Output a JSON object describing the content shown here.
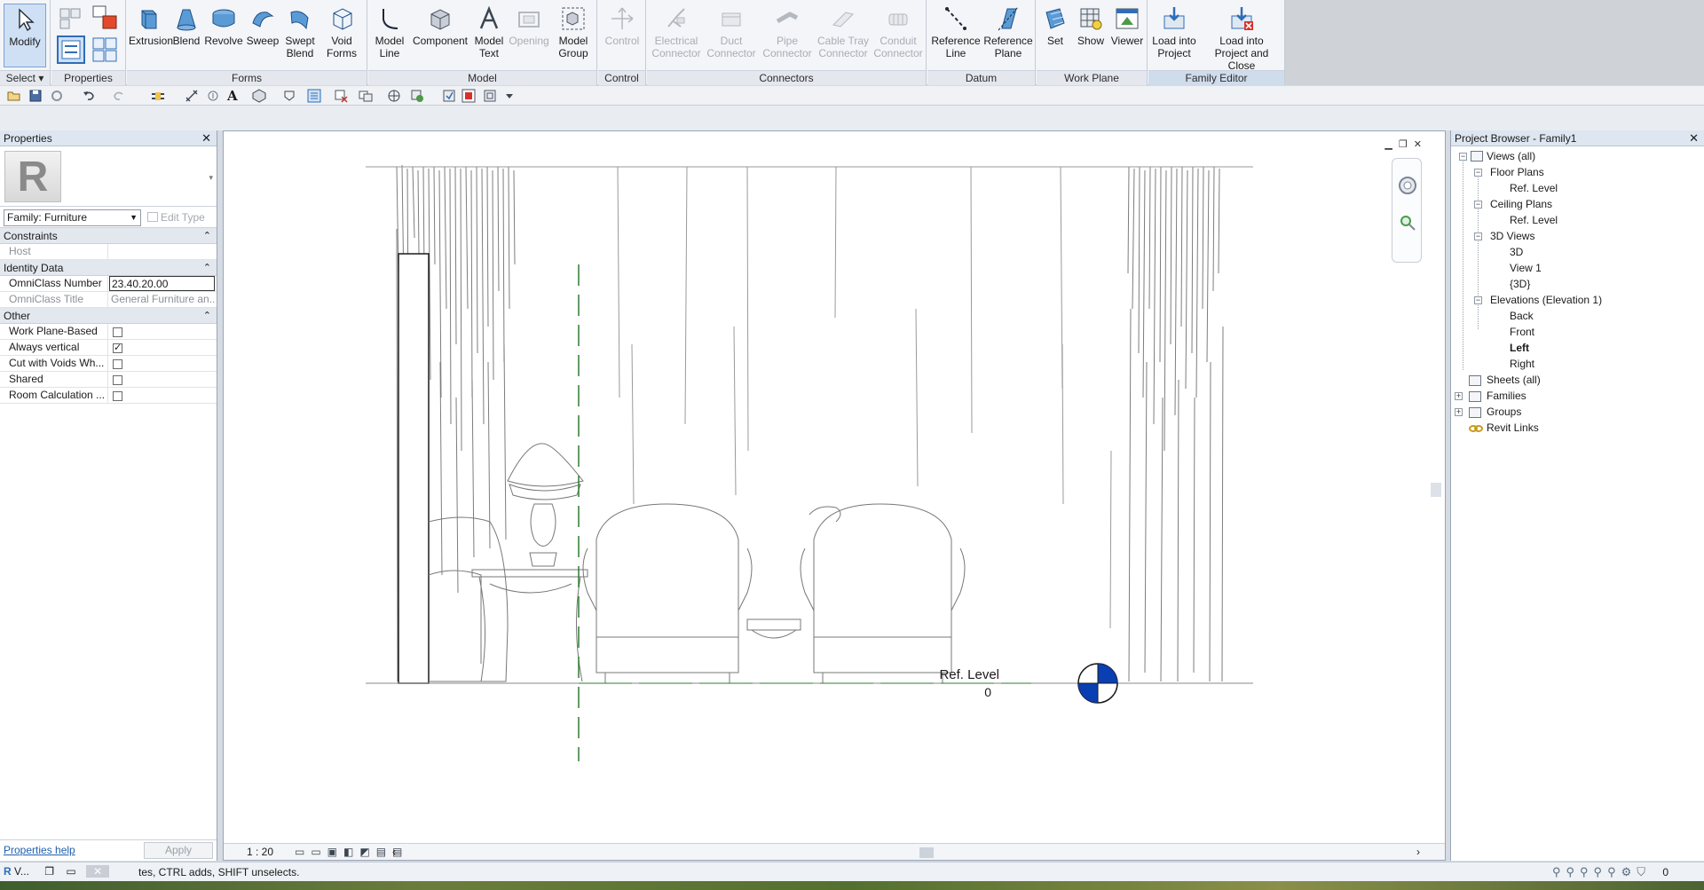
{
  "ribbon": {
    "panels": {
      "select": "Select",
      "properties": "Properties",
      "forms": "Forms",
      "model": "Model",
      "control": "Control",
      "connectors": "Connectors",
      "datum": "Datum",
      "work_plane": "Work Plane",
      "family_editor": "Family Editor"
    },
    "buttons": {
      "modify": "Modify",
      "extrusion": "Extrusion",
      "blend": "Blend",
      "revolve": "Revolve",
      "sweep": "Sweep",
      "swept_blend": "Swept\nBlend",
      "void_forms": "Void\nForms",
      "model_line": "Model\nLine",
      "component": "Component",
      "model_text": "Model\nText",
      "opening": "Opening",
      "model_group": "Model\nGroup",
      "control": "Control",
      "electrical_connector": "Electrical\nConnector",
      "duct_connector": "Duct\nConnector",
      "pipe_connector": "Pipe\nConnector",
      "cable_tray_connector": "Cable Tray\nConnector",
      "conduit_connector": "Conduit\nConnector",
      "reference_line": "Reference\nLine",
      "reference_plane": "Reference\nPlane",
      "set": "Set",
      "show": "Show",
      "viewer": "Viewer",
      "load_into_project": "Load into\nProject",
      "load_into_project_close": "Load into\nProject and Close"
    }
  },
  "properties": {
    "title": "Properties",
    "family_type": "Family: Furniture",
    "edit_type": "Edit Type",
    "logo_letter": "R",
    "categories": {
      "constraints": "Constraints",
      "identity": "Identity Data",
      "other": "Other"
    },
    "rows": {
      "host_label": "Host",
      "omniclass_number_label": "OmniClass Number",
      "omniclass_number_value": "23.40.20.00",
      "omniclass_title_label": "OmniClass Title",
      "omniclass_title_value": "General Furniture an...",
      "work_plane_based": "Work Plane-Based",
      "always_vertical": "Always vertical",
      "cut_with_voids": "Cut with Voids Wh...",
      "shared": "Shared",
      "room_calculation": "Room Calculation ..."
    },
    "checks": {
      "work_plane_based": false,
      "always_vertical": true,
      "cut_with_voids": false,
      "shared": false,
      "room_calculation": false
    },
    "help_link": "Properties help",
    "apply": "Apply"
  },
  "view": {
    "scale": "1 : 20",
    "level_name": "Ref. Level",
    "level_elevation": "0",
    "level_marker_color": "#0a3fb3",
    "ref_plane_color": "#2e7d32"
  },
  "browser": {
    "title": "Project Browser - Family1",
    "tree": {
      "views_all": "Views (all)",
      "floor_plans": "Floor Plans",
      "fp_ref_level": "Ref. Level",
      "ceiling_plans": "Ceiling Plans",
      "cp_ref_level": "Ref. Level",
      "views_3d": "3D Views",
      "v3d": "3D",
      "view1": "View 1",
      "v3d_default": "{3D}",
      "elevations": "Elevations (Elevation 1)",
      "back": "Back",
      "front": "Front",
      "left": "Left",
      "right": "Right",
      "sheets": "Sheets (all)",
      "families": "Families",
      "groups": "Groups",
      "revit_links": "Revit Links"
    }
  },
  "status": {
    "app_label": "V...",
    "message": "tes, CTRL adds, SHIFT unselects.",
    "filter_count": "0"
  }
}
